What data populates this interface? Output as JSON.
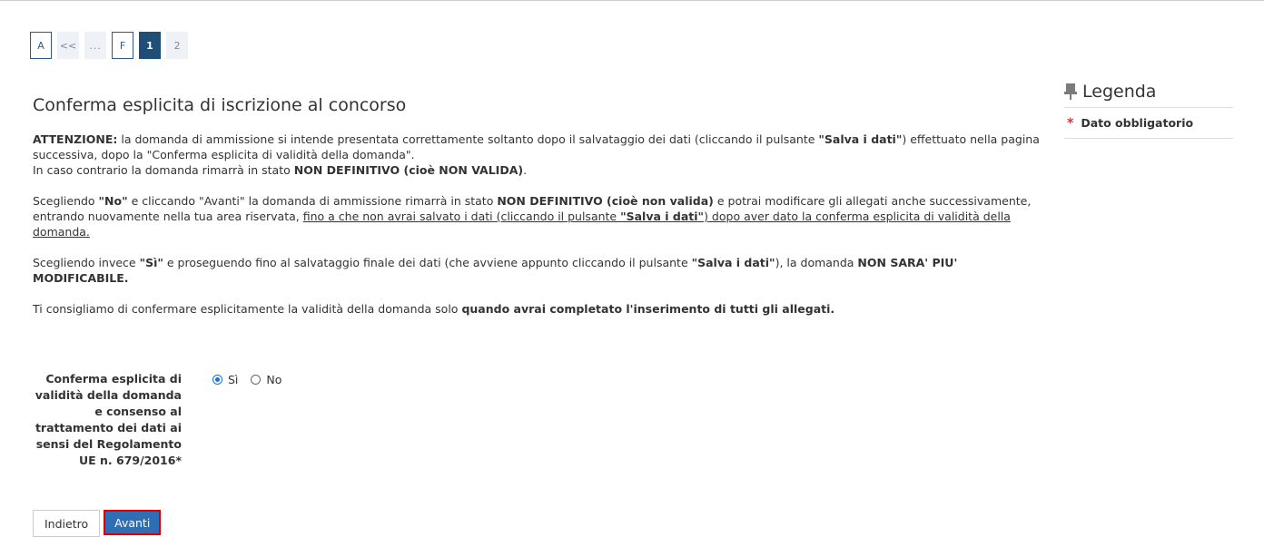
{
  "pagination": {
    "items": [
      {
        "label": "A",
        "state": "done"
      },
      {
        "label": "<<",
        "state": "inactive"
      },
      {
        "label": "...",
        "state": "inactive"
      },
      {
        "label": "F",
        "state": "done"
      },
      {
        "label": "1",
        "state": "active"
      },
      {
        "label": "2",
        "state": "inactive"
      }
    ]
  },
  "page": {
    "title": "Conferma esplicita di iscrizione al concorso"
  },
  "para1": {
    "b1": "ATTENZIONE:",
    "t1": " la domanda di ammissione si intende presentata correttamente soltanto dopo il salvataggio dei dati (cliccando il pulsante ",
    "b2": "\"Salva i dati\"",
    "t2": ") effettuato nella pagina successiva, dopo la \"Conferma esplicita di validità della domanda\".",
    "t3": "In caso contrario la domanda rimarrà in stato ",
    "b3": "NON DEFINITIVO (cioè NON VALIDA)",
    "t4": "."
  },
  "para2": {
    "t1": "Scegliendo ",
    "b1": "\"No\"",
    "t2": " e cliccando \"Avanti\" la domanda di ammissione rimarrà in stato ",
    "b2": "NON DEFINITIVO (cioè non valida)",
    "t3": " e potrai modificare gli allegati anche successivamente, entrando nuovamente nella tua area riservata, ",
    "u1": "fino a che non avrai salvato i dati (cliccando il pulsante ",
    "u2": "\"Salva i dati\"",
    "u3": ") dopo aver dato la conferma esplicita di validità della domanda."
  },
  "para3": {
    "t1": "Scegliendo invece ",
    "b1": "\"Sì\"",
    "t2": " e proseguendo fino al salvataggio finale dei dati (che avviene appunto cliccando il pulsante ",
    "b2": "\"Salva i dati\"",
    "t3": "), la domanda ",
    "b3": "NON SARA' PIU' MODIFICABILE."
  },
  "para4": {
    "t1": "Ti consigliamo di confermare esplicitamente la validità della domanda solo ",
    "b1": "quando avrai completato l'inserimento di tutti gli allegati."
  },
  "form": {
    "label": "Conferma esplicita di validità della domanda e consenso al trattamento dei dati ai sensi del Regolamento UE n. 679/2016*",
    "options": [
      {
        "label": "Sì",
        "checked": true
      },
      {
        "label": "No",
        "checked": false
      }
    ]
  },
  "buttons": {
    "back": "Indietro",
    "next": "Avanti"
  },
  "legend": {
    "title": "Legenda",
    "required_symbol": "*",
    "required_label": "Dato obbligatorio",
    "pin_icon": "pushpin-icon"
  }
}
